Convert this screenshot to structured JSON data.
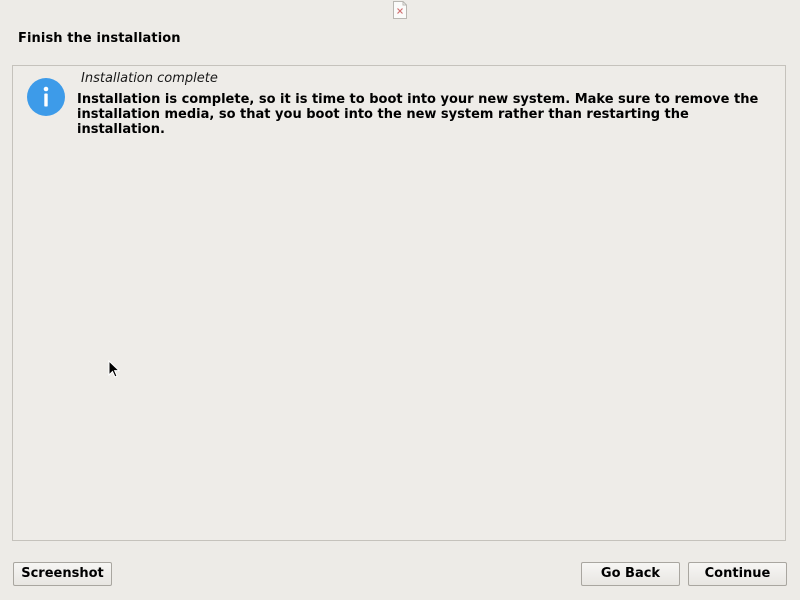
{
  "window": {
    "top_icon": "document-close-icon"
  },
  "step": {
    "title": "Finish the installation"
  },
  "message": {
    "icon": "info-icon",
    "icon_color": "#3d9be9",
    "heading": "Installation complete",
    "body_line1": "Installation is complete, so it is time to boot into your new system. Make sure to remove the",
    "body_line2": "installation media, so that you boot into the new system rather than restarting the installation."
  },
  "buttons": {
    "screenshot": "Screenshot",
    "go_back": "Go Back",
    "continue": "Continue"
  }
}
